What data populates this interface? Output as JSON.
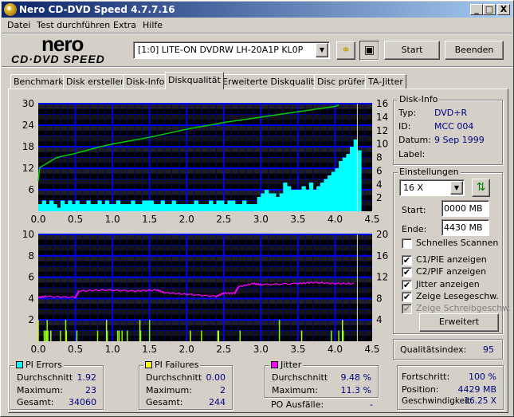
{
  "window": {
    "title": "Nero CD-DVD Speed 4.7.7.16",
    "minimize": "_",
    "maximize": "□",
    "close": "X"
  },
  "menu": [
    "Datei",
    "Test durchführen",
    "Extra",
    "Hilfe"
  ],
  "logo": {
    "top": "nero",
    "bottom": "CD·DVD SPEED"
  },
  "toolbar": {
    "drive": "[1:0]   LITE-ON DVDRW LH-20A1P KL0P",
    "start": "Start",
    "stop": "Beenden"
  },
  "tabs": [
    "Benchmark",
    "Disk erstellen",
    "Disk-Info",
    "Diskqualität",
    "Erweiterte Diskqualität",
    "Disc prüfen",
    "TA-Jitter"
  ],
  "disk_info": {
    "title": "Disk-Info",
    "type_label": "Typ:",
    "type": "DVD+R",
    "id_label": "ID:",
    "id": "MCC 004",
    "date_label": "Datum:",
    "date": "9 Sep 1999",
    "label_label": "Label:"
  },
  "settings": {
    "title": "Einstellungen",
    "speed": "16 X",
    "start_label": "Start:",
    "start": "0000 MB",
    "end_label": "Ende:",
    "end": "4430 MB",
    "checks": [
      {
        "label": "Schnelles Scannen",
        "checked": false,
        "disabled": false
      },
      {
        "label": "C1/PIE anzeigen",
        "checked": true,
        "disabled": false
      },
      {
        "label": "C2/PIF anzeigen",
        "checked": true,
        "disabled": false
      },
      {
        "label": "Jitter anzeigen",
        "checked": true,
        "disabled": false
      },
      {
        "label": "Zeige Lesegeschw.",
        "checked": true,
        "disabled": false
      },
      {
        "label": "Zeige Schreibgeschw.",
        "checked": true,
        "disabled": true
      }
    ],
    "advanced": "Erweitert"
  },
  "quality": {
    "label": "Qualitätsindex:",
    "value": "95"
  },
  "pi_errors": {
    "title": "PI Errors",
    "color": "#00ffff",
    "avg_label": "Durchschnitt",
    "avg": "1.92",
    "max_label": "Maximum:",
    "max": "23",
    "total_label": "Gesamt:",
    "total": "34060"
  },
  "pi_failures": {
    "title": "PI Failures",
    "color": "#ffff00",
    "avg_label": "Durchschnitt",
    "avg": "0.00",
    "max_label": "Maximum:",
    "max": "2",
    "total_label": "Gesamt:",
    "total": "244"
  },
  "jitter": {
    "title": "Jitter",
    "color": "#ff00ff",
    "avg_label": "Durchschnitt",
    "avg": "9.48 %",
    "max_label": "Maximum:",
    "max": "11.3 %"
  },
  "po": {
    "label": "PO Ausfälle:",
    "value": "-"
  },
  "progress": {
    "progress_label": "Fortschritt:",
    "progress": "100 %",
    "position_label": "Position:",
    "position": "4429 MB",
    "speed_label": "Geschwindigkeit:",
    "speed": "16.25 X"
  },
  "chart_data": [
    {
      "type": "bar",
      "title": "PI Errors / Read speed",
      "xlim": [
        0,
        4.5
      ],
      "xticks": [
        "0.0",
        "0.5",
        "1.0",
        "1.5",
        "2.0",
        "2.5",
        "3.0",
        "3.5",
        "4.0",
        "4.5"
      ],
      "ylim": [
        0,
        30
      ],
      "yticks": [
        "6",
        "12",
        "18",
        "24",
        "30"
      ],
      "y2lim": [
        0,
        16
      ],
      "y2ticks": [
        "2",
        "4",
        "6",
        "8",
        "10",
        "12",
        "14",
        "16"
      ],
      "pi_errors": {
        "x_start": 0,
        "x_step": 0.05,
        "values": [
          2,
          3,
          2,
          3,
          2,
          1,
          3,
          2,
          3,
          2,
          3,
          2,
          2,
          3,
          2,
          2,
          3,
          2,
          3,
          2,
          2,
          3,
          2,
          2,
          2,
          3,
          2,
          2,
          3,
          3,
          3,
          2,
          2,
          3,
          2,
          2,
          3,
          2,
          2,
          2,
          2,
          2,
          3,
          2,
          2,
          2,
          3,
          2,
          3,
          3,
          2,
          3,
          3,
          2,
          2,
          3,
          2,
          2,
          2,
          4,
          5,
          6,
          5,
          5,
          4,
          5,
          8,
          7,
          6,
          6,
          6,
          7,
          6,
          8,
          6,
          7,
          8,
          9,
          10,
          11,
          12,
          14,
          15,
          16,
          18,
          20,
          17
        ]
      },
      "read_speed": {
        "x": [
          0,
          0.02,
          0.25,
          0.5,
          0.8,
          1.0,
          1.5,
          2.0,
          2.5,
          3.0,
          3.5,
          4.0,
          4.05
        ],
        "y": [
          4.5,
          6.5,
          8,
          8.6,
          9.5,
          10,
          11,
          12.2,
          13.2,
          14,
          14.8,
          15.6,
          15.8
        ]
      },
      "end_marker": 4.3
    },
    {
      "type": "bar",
      "title": "PI Failures / Jitter",
      "xlim": [
        0,
        4.5
      ],
      "xticks": [
        "0.0",
        "0.5",
        "1.0",
        "1.5",
        "2.0",
        "2.5",
        "3.0",
        "3.5",
        "4.0",
        "4.5"
      ],
      "ylim": [
        0,
        10
      ],
      "yticks": [
        "2",
        "4",
        "6",
        "8",
        "10"
      ],
      "y2lim": [
        0,
        20
      ],
      "y2ticks": [
        "4",
        "8",
        "12",
        "16",
        "20"
      ],
      "pi_failures": {
        "x": [
          0,
          0.08,
          0.1,
          0.11,
          0.12,
          0.13,
          0.17,
          0.3,
          0.37,
          0.38,
          0.52,
          0.8,
          0.92,
          0.93,
          1.07,
          1.09,
          1.13,
          1.2,
          1.37,
          1.38,
          1.5,
          2.05,
          2.2,
          2.42,
          2.43,
          2.72,
          3.25,
          3.55,
          3.95,
          4.05,
          4.1,
          4.11
        ],
        "y": [
          2,
          1,
          1,
          1,
          2,
          1,
          1,
          1,
          2,
          1,
          1,
          1,
          2,
          1,
          1,
          1,
          1,
          1,
          2,
          1,
          2,
          1,
          1,
          1,
          1,
          1,
          2,
          1,
          1,
          1,
          2,
          1
        ]
      },
      "jitter": {
        "x": [
          0,
          0.1,
          0.5,
          0.55,
          0.9,
          1.3,
          1.6,
          1.7,
          2.0,
          2.4,
          2.5,
          2.65,
          2.7,
          2.9,
          3.0,
          3.5,
          3.7,
          4.0,
          4.28
        ],
        "y": [
          8.2,
          8.4,
          8.2,
          9.4,
          9.6,
          9.4,
          9.6,
          9.1,
          8.8,
          8.4,
          9.0,
          9.0,
          10.2,
          10.8,
          10.6,
          10.8,
          11.0,
          10.8,
          10.8
        ]
      },
      "end_marker": 4.3
    }
  ]
}
